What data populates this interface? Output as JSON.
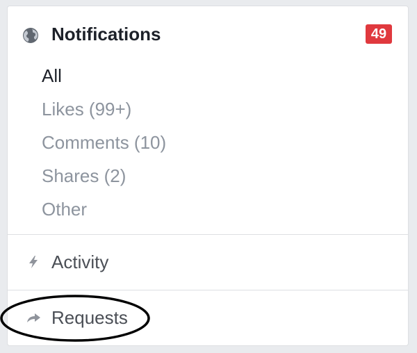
{
  "notifications": {
    "title": "Notifications",
    "badge_count": "49",
    "icon": "globe-icon",
    "badge_color": "#e0393e"
  },
  "filters": [
    {
      "label": "All",
      "active": true
    },
    {
      "label": "Likes (99+)",
      "active": false
    },
    {
      "label": "Comments (10)",
      "active": false
    },
    {
      "label": "Shares (2)",
      "active": false
    },
    {
      "label": "Other",
      "active": false
    }
  ],
  "activity": {
    "label": "Activity",
    "icon": "lightning-bolt-icon"
  },
  "requests": {
    "label": "Requests",
    "icon": "share-arrow-icon"
  },
  "annotation": {
    "shape": "ellipse",
    "target": "requests",
    "color": "#000000"
  }
}
